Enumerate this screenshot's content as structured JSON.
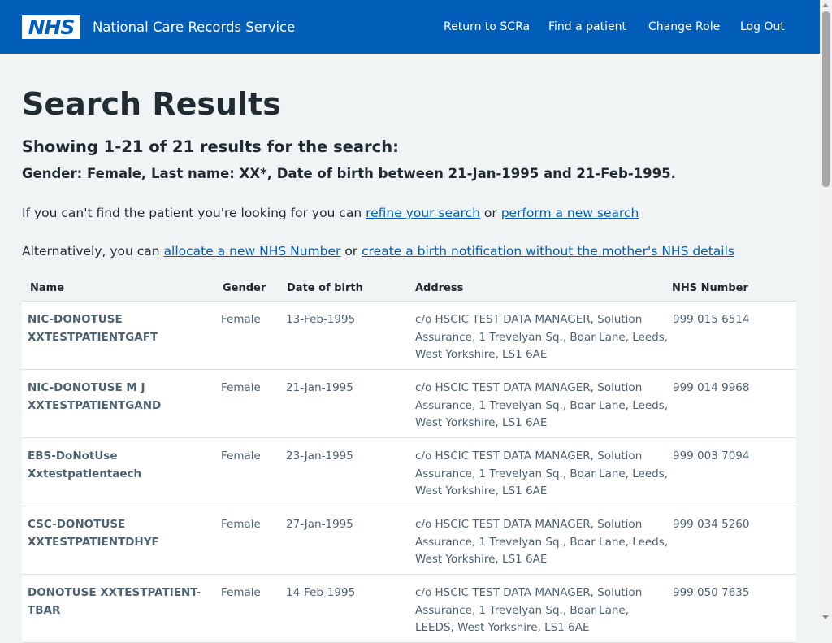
{
  "header": {
    "logo_text": "NHS",
    "service_name": "National Care Records Service",
    "nav": [
      {
        "label": "Return to SCRa"
      },
      {
        "label": "Find a patient"
      },
      {
        "label": "Change Role"
      },
      {
        "label": "Log Out"
      }
    ]
  },
  "main": {
    "title": "Search Results",
    "summary": "Showing 1-21 of 21 results for the search:",
    "criteria": "Gender: Female, Last name: XX*, Date of birth between 21-Jan-1995 and 21-Feb-1995.",
    "refine_text_before": "If you can't find the patient you're looking for you can ",
    "refine_link": "refine your search",
    "refine_text_mid": " or ",
    "new_search_link": "perform a new search",
    "alt_text_before": "Alternatively, you can ",
    "allocate_link": "allocate a new NHS Number",
    "alt_text_mid": " or ",
    "birth_link": "create a birth notification without the mother's NHS details"
  },
  "table": {
    "columns": [
      "Name",
      "Gender",
      "Date of birth",
      "Address",
      "NHS Number"
    ],
    "rows": [
      {
        "name": "NIC-DONOTUSE XXTESTPATIENTGAFT",
        "gender": "Female",
        "dob": "13-Feb-1995",
        "address": "c/o HSCIC TEST DATA MANAGER, Solution Assurance, 1 Trevelyan Sq., Boar Lane, Leeds, West Yorkshire, LS1 6AE",
        "nhs": "999 015 6514"
      },
      {
        "name": "NIC-DONOTUSE M J XXTESTPATIENTGAND",
        "gender": "Female",
        "dob": "21-Jan-1995",
        "address": "c/o HSCIC TEST DATA MANAGER, Solution Assurance, 1 Trevelyan Sq., Boar Lane, Leeds, West Yorkshire, LS1 6AE",
        "nhs": "999 014 9968"
      },
      {
        "name": "EBS-DoNotUse Xxtestpatientaech",
        "gender": "Female",
        "dob": "23-Jan-1995",
        "address": "c/o HSCIC TEST DATA MANAGER, Solution Assurance, 1 Trevelyan Sq., Boar Lane, Leeds, West Yorkshire, LS1 6AE",
        "nhs": "999 003 7094"
      },
      {
        "name": "CSC-DONOTUSE XXTESTPATIENTDHYF",
        "gender": "Female",
        "dob": "27-Jan-1995",
        "address": "c/o HSCIC TEST DATA MANAGER, Solution Assurance, 1 Trevelyan Sq., Boar Lane, Leeds, West Yorkshire, LS1 6AE",
        "nhs": "999 034 5260"
      },
      {
        "name": "DONOTUSE XXTESTPATIENT-TBAR",
        "gender": "Female",
        "dob": "14-Feb-1995",
        "address": "c/o HSCIC TEST DATA MANAGER, Solution Assurance, 1 Trevelyan Sq., Boar Lane, LEEDS, West Yorkshire, LS1 6AE",
        "nhs": "999 050 7635"
      }
    ]
  }
}
